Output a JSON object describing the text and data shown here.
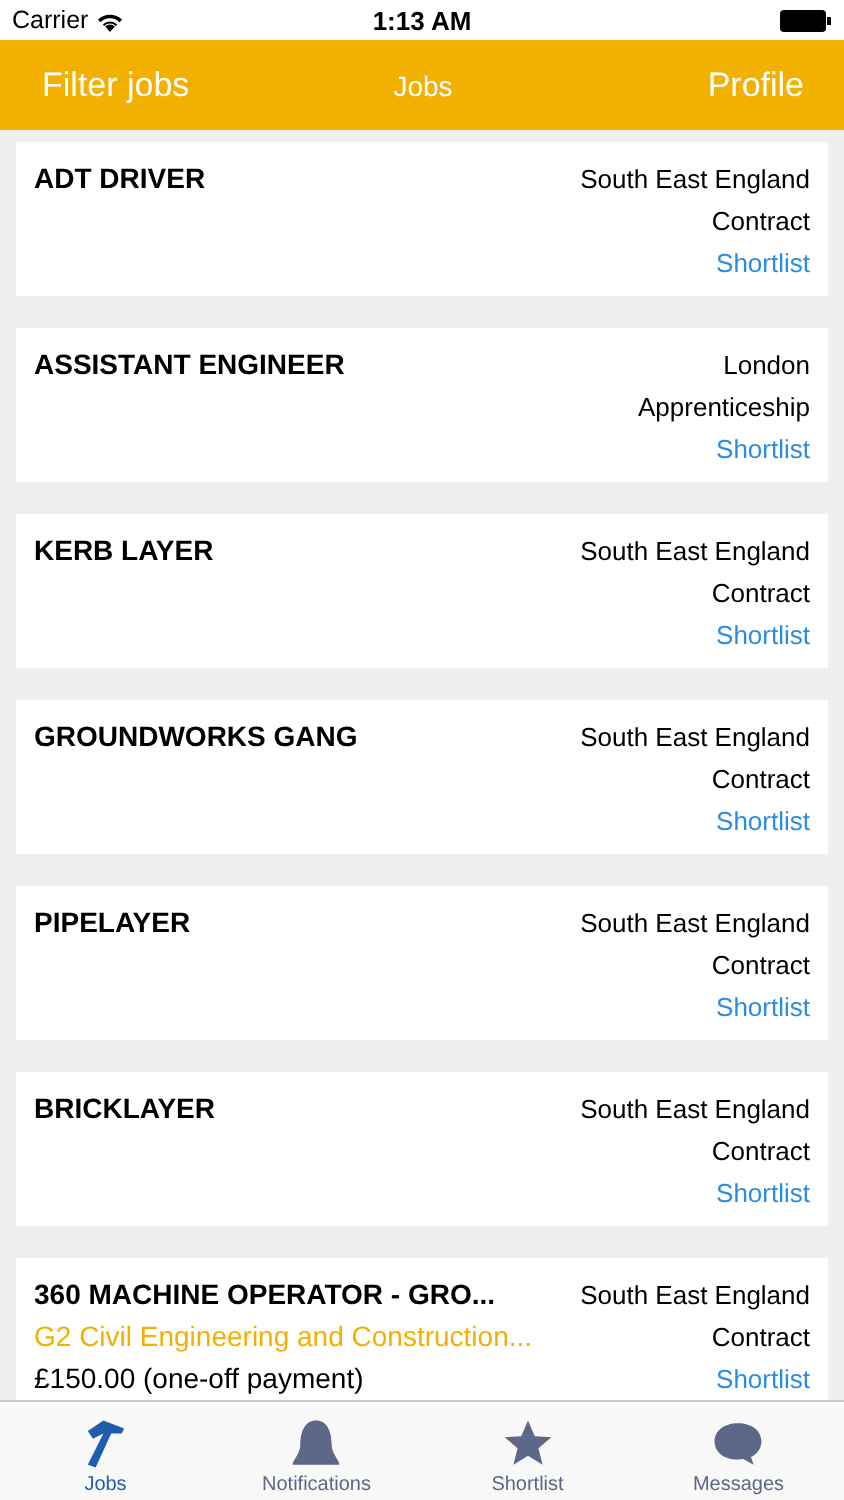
{
  "status_bar": {
    "carrier": "Carrier",
    "time": "1:13 AM"
  },
  "nav_bar": {
    "left": "Filter jobs",
    "title": "Jobs",
    "right": "Profile"
  },
  "jobs": [
    {
      "title": "ADT DRIVER",
      "location": "South East England",
      "type": "Contract",
      "action": "Shortlist"
    },
    {
      "title": "ASSISTANT ENGINEER",
      "location": "London",
      "type": "Apprenticeship",
      "action": "Shortlist"
    },
    {
      "title": "KERB LAYER",
      "location": "South East England",
      "type": "Contract",
      "action": "Shortlist"
    },
    {
      "title": "GROUNDWORKS GANG",
      "location": "South East England",
      "type": "Contract",
      "action": "Shortlist"
    },
    {
      "title": "PIPELAYER",
      "location": "South East England",
      "type": "Contract",
      "action": "Shortlist"
    },
    {
      "title": "BRICKLAYER",
      "location": "South East England",
      "type": "Contract",
      "action": "Shortlist"
    },
    {
      "title": "360 MACHINE OPERATOR - GRO...",
      "company": "G2 Civil Engineering and Construction...",
      "pay": "£150.00 (one-off payment)",
      "location": "South East England",
      "type": "Contract",
      "action": "Shortlist"
    }
  ],
  "tabs": [
    {
      "kind": "hammer",
      "label": "Jobs",
      "selected": true
    },
    {
      "kind": "bell",
      "label": "Notifications",
      "selected": false
    },
    {
      "kind": "star",
      "label": "Shortlist",
      "selected": false
    },
    {
      "kind": "chat",
      "label": "Messages",
      "selected": false
    }
  ]
}
